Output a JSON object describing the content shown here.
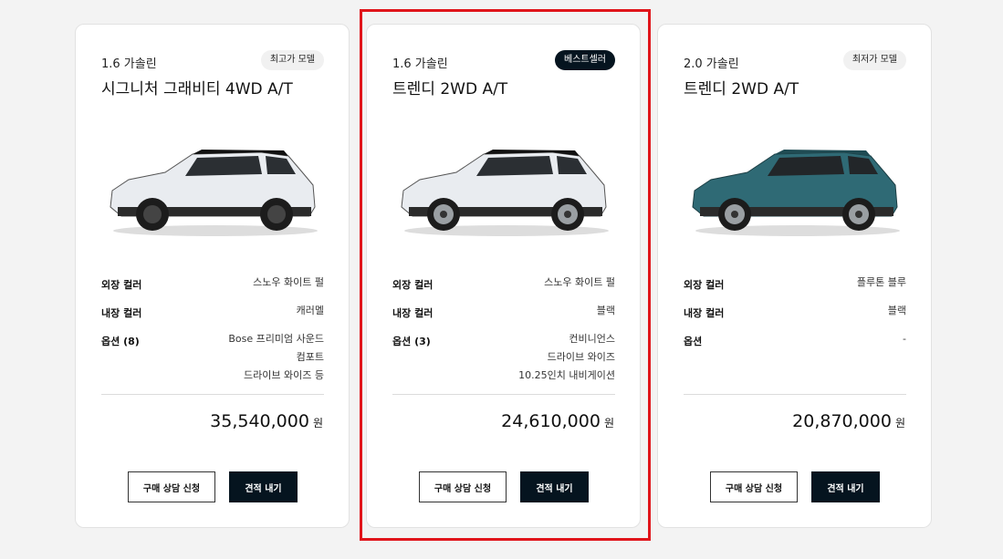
{
  "cards": [
    {
      "engine": "1.6 가솔린",
      "badge": "최고가 모델",
      "trim": "시그니처 그래비티 4WD A/T",
      "car_color": "#e9ecf0",
      "specs": {
        "exterior_label": "외장 컬러",
        "exterior_value": "스노우 화이트 펄",
        "interior_label": "내장 컬러",
        "interior_value": "캐러멜",
        "options_label": "옵션 (8)",
        "options_values": [
          "Bose 프리미엄 사운드",
          "컴포트",
          "드라이브 와이즈 등"
        ]
      },
      "price": "35,540,000",
      "currency": "원",
      "consult_button": "구매 상담 신청",
      "quote_button": "견적 내기"
    },
    {
      "engine": "1.6 가솔린",
      "badge": "베스트셀러",
      "trim": "트렌디 2WD A/T",
      "car_color": "#e9ecf0",
      "specs": {
        "exterior_label": "외장 컬러",
        "exterior_value": "스노우 화이트 펄",
        "interior_label": "내장 컬러",
        "interior_value": "블랙",
        "options_label": "옵션 (3)",
        "options_values": [
          "컨비니언스",
          "드라이브 와이즈",
          "10.25인치 내비게이션"
        ]
      },
      "price": "24,610,000",
      "currency": "원",
      "consult_button": "구매 상담 신청",
      "quote_button": "견적 내기"
    },
    {
      "engine": "2.0 가솔린",
      "badge": "최저가 모델",
      "trim": "트렌디 2WD A/T",
      "car_color": "#2f6a75",
      "specs": {
        "exterior_label": "외장 컬러",
        "exterior_value": "플루톤 블루",
        "interior_label": "내장 컬러",
        "interior_value": "블랙",
        "options_label": "옵션",
        "options_values": [
          "-",
          "",
          ""
        ]
      },
      "price": "20,870,000",
      "currency": "원",
      "consult_button": "구매 상담 신청",
      "quote_button": "견적 내기"
    }
  ],
  "colors": {
    "accent_dark": "#05141f",
    "highlight_border": "#e0151b"
  }
}
